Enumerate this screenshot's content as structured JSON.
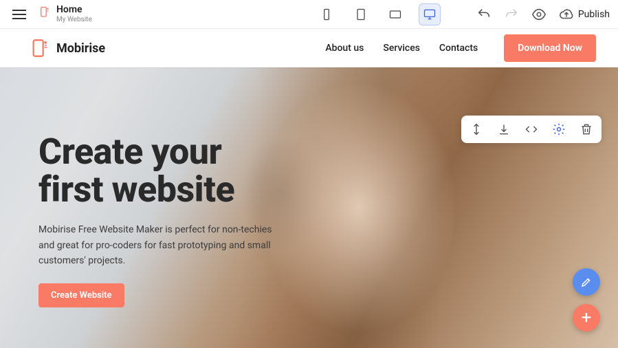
{
  "app": {
    "page_title": "Home",
    "site_subtitle": "My Website",
    "publish_label": "Publish",
    "devices": {
      "active": "desktop"
    }
  },
  "site_nav": {
    "brand": "Mobirise",
    "links": [
      {
        "label": "About us"
      },
      {
        "label": "Services"
      },
      {
        "label": "Contacts"
      }
    ],
    "cta": "Download Now"
  },
  "hero": {
    "title": "Create your\nfirst website",
    "subtitle": "Mobirise Free Website Maker is perfect for non-techies and great for pro-coders for fast prototyping and small customers' projects.",
    "button": "Create Website"
  },
  "colors": {
    "accent": "#f97b65",
    "primary_blue": "#3a62d8"
  }
}
